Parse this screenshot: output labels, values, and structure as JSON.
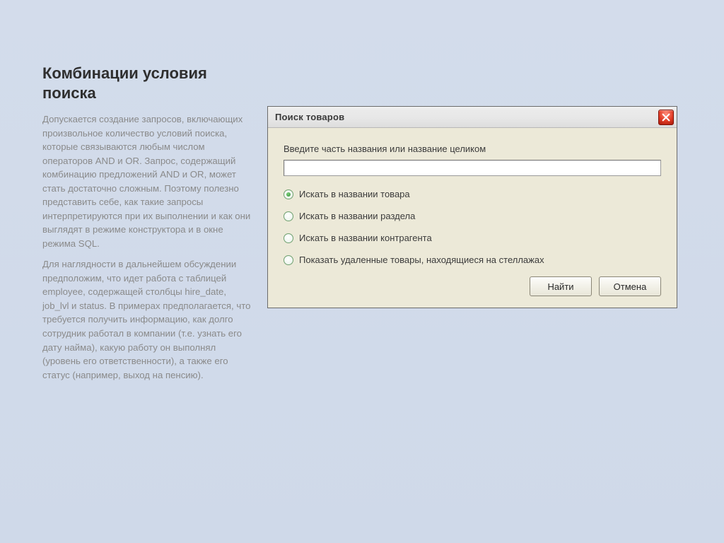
{
  "title": "Комбинации условия поиска",
  "para1": "Допускается создание запросов, включающих произвольное количество условий поиска, которые связываются любым числом операторов AND и OR. Запрос, содержащий комбинацию предложений AND и OR, может стать достаточно сложным. Поэтому полезно представить себе, как такие запросы интерпретируются при их выполнении и как они выглядят в режиме конструктора и в окне режима SQL.",
  "para2": "Для наглядности в дальнейшем обсуждении предположим, что идет работа с таблицей employee, содержащей столбцы hire_date, job_lvl и status. В примерах предполагается, что требуется получить информацию, как долго сотрудник работал в компании (т.е. узнать его дату найма), какую работу он выполнял (уровень его ответственности), а также его статус (например, выход на пенсию).",
  "dialog": {
    "title": "Поиск товаров",
    "prompt": "Введите часть названия или название целиком",
    "input_value": "",
    "options": [
      "Искать в названии товара",
      "Искать в названии раздела",
      "Искать в названии контрагента",
      "Показать удаленные товары, находящиеся на стеллажах"
    ],
    "selected_index": 0,
    "buttons": {
      "find": "Найти",
      "cancel": "Отмена"
    }
  }
}
